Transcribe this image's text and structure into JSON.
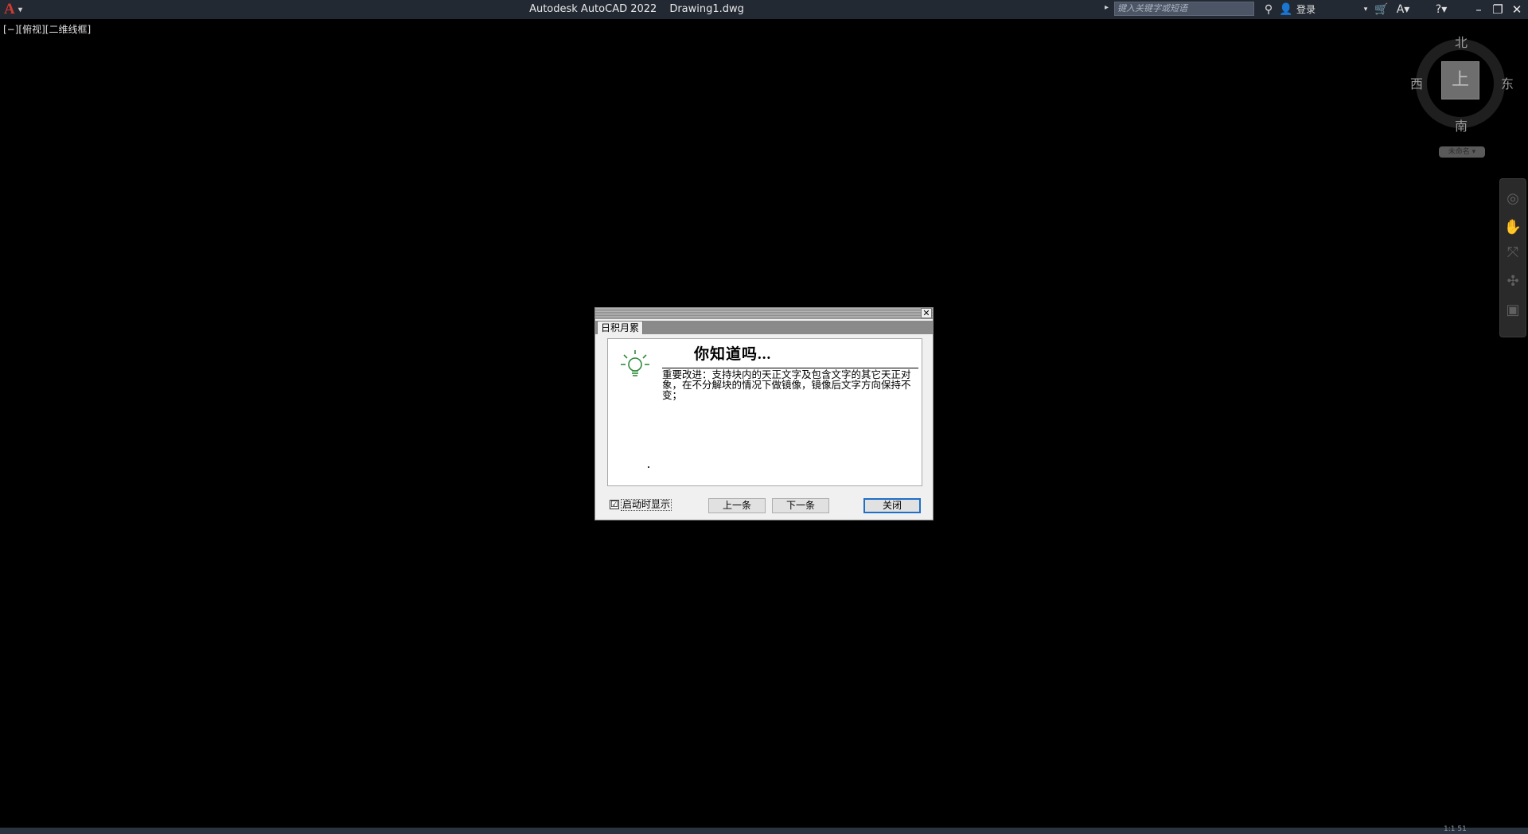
{
  "titlebar": {
    "app_name": "Autodesk AutoCAD 2022",
    "document": "Drawing1.dwg",
    "search_placeholder": "键入关键字或短语",
    "login_label": "登录"
  },
  "viewport": {
    "label": "[−][俯视][二维线框]"
  },
  "viewcube": {
    "north": "北",
    "south": "南",
    "west": "西",
    "east": "东",
    "face": "上",
    "wcs_label": "未命名 ▾"
  },
  "dialog": {
    "tab_label": "日积月累",
    "heading": "你知道吗...",
    "body": "重要改进：支持块内的天正文字及包含文字的其它天正对象，在不分解块的情况下做镜像，镜像后文字方向保持不变；",
    "show_on_startup_label": "启动时显示",
    "show_on_startup_checked": "☑",
    "prev_label": "上一条",
    "next_label": "下一条",
    "close_label": "关闭"
  },
  "statusbar": {
    "text": "1:1 51"
  }
}
